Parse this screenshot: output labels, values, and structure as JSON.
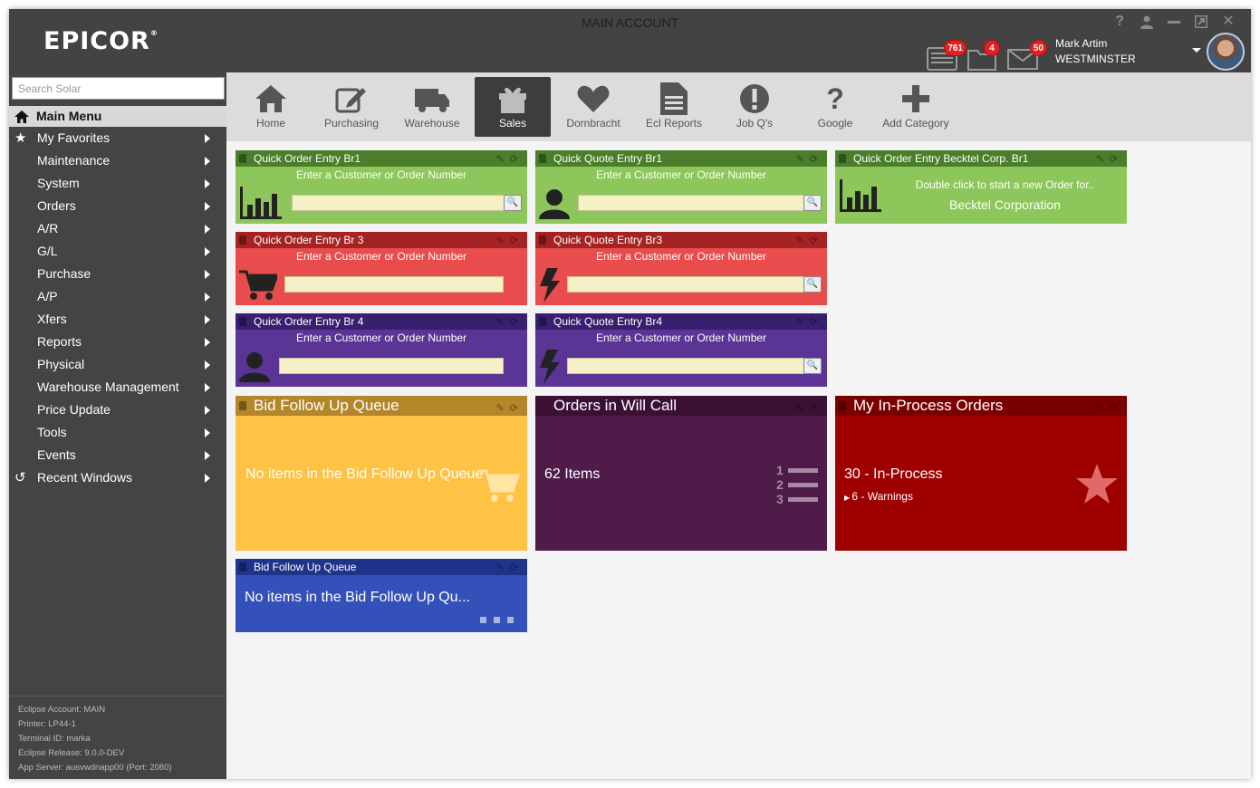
{
  "window": {
    "title": "MAIN ACCOUNT",
    "controls": [
      "?",
      "user",
      "minimize",
      "restore",
      "close"
    ]
  },
  "brand": {
    "logo_text": "EPICOR",
    "logo_mark": "®"
  },
  "notifications": [
    {
      "icon": "list-icon",
      "count": "761"
    },
    {
      "icon": "folder-icon",
      "count": "4"
    },
    {
      "icon": "mail-icon",
      "count": "50"
    }
  ],
  "user": {
    "name": "Mark Artim",
    "branch": "WESTMINSTER"
  },
  "sidebar": {
    "search_placeholder": "Search Solar",
    "main_menu_label": "Main Menu",
    "items": [
      {
        "label": "My Favorites",
        "icon": "star-icon"
      },
      {
        "label": "Maintenance"
      },
      {
        "label": "System"
      },
      {
        "label": "Orders"
      },
      {
        "label": "A/R"
      },
      {
        "label": "G/L"
      },
      {
        "label": "Purchase"
      },
      {
        "label": "A/P"
      },
      {
        "label": "Xfers"
      },
      {
        "label": "Reports"
      },
      {
        "label": "Physical"
      },
      {
        "label": "Warehouse Management"
      },
      {
        "label": "Price Update"
      },
      {
        "label": "Tools"
      },
      {
        "label": "Events"
      },
      {
        "label": "Recent Windows",
        "icon": "history-icon"
      }
    ],
    "footer": [
      "Eclipse Account: MAIN",
      "Printer: LP44-1",
      "Terminal ID: marka",
      "Eclipse Release: 9.0.0-DEV",
      "App Server: ausvwdnapp00 (Port: 2080)"
    ]
  },
  "toolbar": {
    "active": "Sales",
    "items": [
      "Home",
      "Purchasing",
      "Warehouse",
      "Sales",
      "Dornbracht",
      "Ecl Reports",
      "Job Q's",
      "Google",
      "Add Category"
    ]
  },
  "tiles": {
    "qoe_br1": {
      "title": "Quick Order Entry Br1",
      "prompt": "Enter a Customer or Order Number",
      "color": "#8dc65a"
    },
    "qqe_br1": {
      "title": "Quick Quote Entry Br1",
      "prompt": "Enter a Customer or Order Number",
      "color": "#8dc65a"
    },
    "qoe_becktel": {
      "title": "Quick Order Entry Becktel Corp. Br1",
      "line1": "Double click to start a new Order for..",
      "line2": "Becktel Corporation",
      "color": "#8dc65a"
    },
    "qoe_br3": {
      "title": "Quick Order Entry Br 3",
      "prompt": "Enter a Customer or Order Number",
      "color": "#e84c4c"
    },
    "qqe_br3": {
      "title": "Quick Quote Entry Br3",
      "prompt": "Enter a Customer or Order Number",
      "color": "#e84c4c"
    },
    "qoe_br4": {
      "title": "Quick Order Entry Br 4",
      "prompt": "Enter a Customer or Order Number",
      "color": "#5a3596"
    },
    "qqe_br4": {
      "title": "Quick Quote Entry Br4",
      "prompt": "Enter a Customer or Order Number",
      "color": "#5a3596"
    },
    "bid_queue": {
      "title": "Bid Follow Up Queue",
      "text": "No items in the Bid Follow Up Queue",
      "color": "#fec244"
    },
    "will_call": {
      "title": "Orders in Will Call",
      "text": "62 Items",
      "color": "#4f1c4a"
    },
    "in_process": {
      "title": "My In-Process Orders",
      "text": "30 - In-Process",
      "sub": "6 - Warnings",
      "color": "#9e0000"
    },
    "bid_queue_small": {
      "title": "Bid Follow Up Queue",
      "text": "No items in the Bid Follow Up Qu...",
      "color": "#3351b8"
    }
  }
}
